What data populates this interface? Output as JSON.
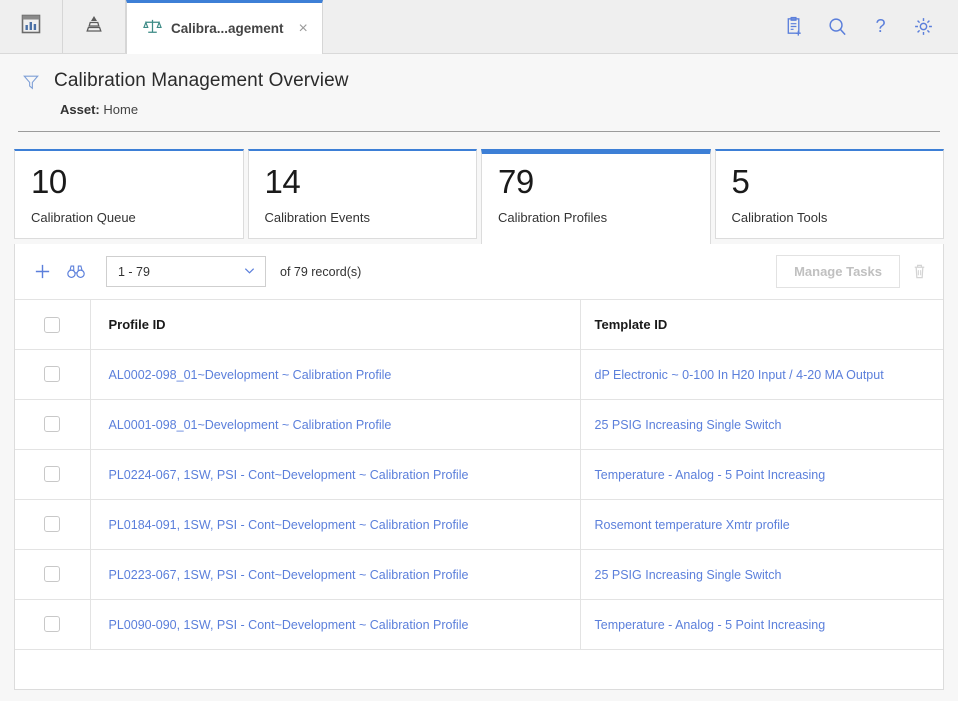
{
  "tabbar": {
    "nav_icons": [
      {
        "name": "dashboard-icon",
        "title": "Dashboards"
      },
      {
        "name": "pyramid-hierarchy-icon",
        "title": "Asset Hierarchy"
      }
    ],
    "active_tab": {
      "icon": "scales-balance-icon",
      "label": "Calibra...agement",
      "close_label": "×"
    },
    "actions": [
      {
        "name": "clipboard-add-icon",
        "title": "New Record"
      },
      {
        "name": "search-icon",
        "title": "Search"
      },
      {
        "name": "help-icon",
        "title": "Help",
        "glyph": "?"
      },
      {
        "name": "gear-icon",
        "title": "Settings"
      }
    ]
  },
  "header": {
    "filter_icon": "funnel-filter-icon",
    "title": "Calibration Management Overview",
    "asset_label": "Asset:",
    "asset_value": "Home"
  },
  "cards": [
    {
      "value": "10",
      "label": "Calibration Queue",
      "active": false
    },
    {
      "value": "14",
      "label": "Calibration Events",
      "active": false
    },
    {
      "value": "79",
      "label": "Calibration Profiles",
      "active": true
    },
    {
      "value": "5",
      "label": "Calibration Tools",
      "active": false
    }
  ],
  "toolbar": {
    "add_icon": "plus-add-icon",
    "binoculars_icon": "binoculars-search-icon",
    "page_range": "1 - 79",
    "dropdown_icon": "chevron-down-icon",
    "record_count": "of 79 record(s)",
    "manage_tasks_label": "Manage Tasks",
    "delete_icon": "trash-delete-icon"
  },
  "table": {
    "columns": [
      "Profile ID",
      "Template ID"
    ],
    "rows": [
      {
        "profile_id": "AL0002-098_01~Development ~ Calibration Profile",
        "template_id": "dP Electronic ~ 0-100 In H20 Input / 4-20 MA Output"
      },
      {
        "profile_id": "AL0001-098_01~Development ~ Calibration Profile",
        "template_id": "25 PSIG Increasing Single Switch"
      },
      {
        "profile_id": "PL0224-067, 1SW, PSI - Cont~Development ~ Calibration Profile",
        "template_id": "Temperature - Analog - 5 Point Increasing"
      },
      {
        "profile_id": "PL0184-091, 1SW, PSI - Cont~Development ~ Calibration Profile",
        "template_id": "Rosemont temperature Xmtr profile"
      },
      {
        "profile_id": "PL0223-067, 1SW, PSI - Cont~Development ~ Calibration Profile",
        "template_id": "25 PSIG Increasing Single Switch"
      },
      {
        "profile_id": "PL0090-090, 1SW, PSI - Cont~Development ~ Calibration Profile",
        "template_id": "Temperature - Analog - 5 Point Increasing"
      }
    ]
  },
  "colors": {
    "accent_blue": "#3d7fd6",
    "link_blue": "#5b7fdb",
    "icon_blue": "#5b7fdb",
    "tab_icon_teal": "#3b8a85",
    "page_bg": "#f7f7f7"
  }
}
